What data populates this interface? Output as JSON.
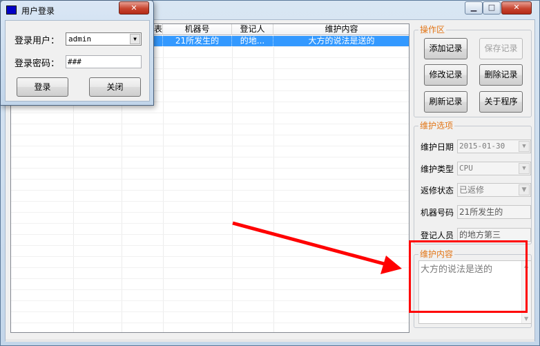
{
  "grid": {
    "columns": [
      "",
      "",
      "",
      "",
      "机器号",
      "登记人",
      "维护内容"
    ],
    "header_partial": "表",
    "rows": [
      {
        "c4": "21所发生的",
        "c5": "的地...",
        "c6": "大方的说法是送的"
      }
    ]
  },
  "ops": {
    "title": "操作区",
    "add": "添加记录",
    "save": "保存记录",
    "edit": "修改记录",
    "delete": "删除记录",
    "refresh": "刷新记录",
    "about": "关于程序"
  },
  "options": {
    "title": "维护选项",
    "date_label": "维护日期",
    "date_value": "2015-01-30",
    "type_label": "维护类型",
    "type_value": "CPU",
    "status_label": "返修状态",
    "status_value": "已返修",
    "machine_label": "机器号码",
    "machine_value": "21所发生的",
    "person_label": "登记人员",
    "person_value": "的地方第三"
  },
  "content": {
    "title": "维护内容",
    "value": "大方的说法是送的"
  },
  "login": {
    "title": "用户登录",
    "user_label": "登录用户：",
    "user_value": "admin",
    "pwd_label": "登录密码：",
    "pwd_value": "###",
    "login_btn": "登录",
    "close_btn": "关闭"
  },
  "colors": {
    "selection": "#3399ff",
    "group_title": "#e2771a",
    "annotation": "#ff0000"
  }
}
